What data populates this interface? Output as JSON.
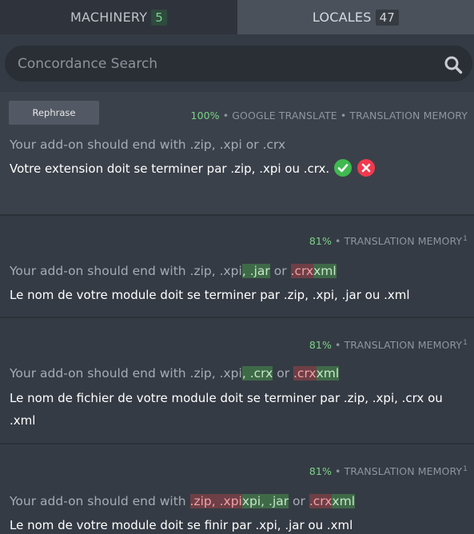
{
  "tabs": {
    "machinery": {
      "label": "MACHINERY",
      "count": "5"
    },
    "locales": {
      "label": "LOCALES",
      "count": "47"
    }
  },
  "search": {
    "placeholder": "Concordance Search"
  },
  "entries": [
    {
      "rephrase_label": "Rephrase",
      "quality": "100%",
      "sources": " • GOOGLE TRANSLATE • TRANSLATION MEMORY",
      "original": "Your add-on should end with .zip, .xpi or .crx",
      "translation": "Votre extension doit se terminer par .zip, .xpi ou .crx."
    },
    {
      "quality": "81%",
      "sources": " • TRANSLATION MEMORY",
      "count_sup": "1",
      "original_a": "Your add-on should end with .zip, .xpi",
      "original_ins1": ", .jar",
      "original_b": " or ",
      "original_del": ".crx",
      "original_ins2": "xml",
      "translation": "Le nom de votre module doit se terminer par .zip, .xpi, .jar ou .xml"
    },
    {
      "quality": "81%",
      "sources": " • TRANSLATION MEMORY",
      "count_sup": "1",
      "original_a": "Your add-on should end with .zip, .xpi",
      "original_ins1": ", .crx",
      "original_b": " or ",
      "original_del": ".crx",
      "original_ins2": "xml",
      "translation": "Le nom de fichier de votre module doit se terminer par .zip, .xpi, .crx ou .xml"
    },
    {
      "quality": "81%",
      "sources": " • TRANSLATION MEMORY",
      "count_sup": "1",
      "original_a": "Your add-on should end with ",
      "original_del1": ".zip, .xpi",
      "original_ins1": "xpi, .jar",
      "original_b": " or ",
      "original_del2": ".crx",
      "original_ins2": "xml",
      "translation": "Le nom de votre module doit se finir par .xpi, .jar ou .xml"
    }
  ],
  "colors": {
    "accent_green": "#7bd389",
    "accept": "#3fb950",
    "reject": "#f1394e"
  },
  "icons": [
    "search-icon",
    "check-icon",
    "close-icon"
  ]
}
